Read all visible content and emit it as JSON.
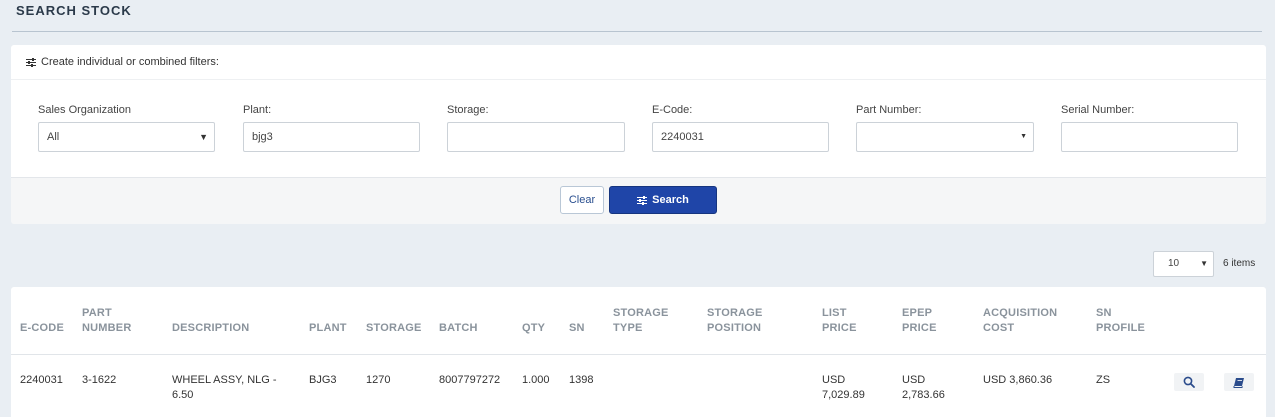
{
  "page": {
    "title": "SEARCH STOCK"
  },
  "filters": {
    "heading": "Create individual or combined filters:",
    "fields": [
      {
        "label": "Sales Organization",
        "value": "All",
        "type": "select"
      },
      {
        "label": "Plant:",
        "value": "bjg3",
        "type": "text"
      },
      {
        "label": "Storage:",
        "value": "",
        "type": "text"
      },
      {
        "label": "E-Code:",
        "value": "2240031",
        "type": "text"
      },
      {
        "label": "Part Number:",
        "value": "",
        "type": "select"
      },
      {
        "label": "Serial Number:",
        "value": "",
        "type": "text"
      }
    ],
    "clear_label": "Clear",
    "search_label": "Search"
  },
  "pager": {
    "page_size": "10",
    "items_text": "6 items"
  },
  "table": {
    "headers": {
      "ecode": [
        "E-CODE"
      ],
      "part_number": [
        "PART",
        "NUMBER"
      ],
      "description": [
        "DESCRIPTION"
      ],
      "plant": [
        "PLANT"
      ],
      "storage": [
        "STORAGE"
      ],
      "batch": [
        "BATCH"
      ],
      "qty": [
        "QTY"
      ],
      "sn": [
        "SN"
      ],
      "storage_type": [
        "STORAGE",
        "TYPE"
      ],
      "storage_position": [
        "STORAGE",
        "POSITION"
      ],
      "list_price": [
        "LIST",
        "PRICE"
      ],
      "epep_price": [
        "EPEP",
        "PRICE"
      ],
      "acquisition_cost": [
        "ACQUISITION",
        "COST"
      ],
      "sn_profile": [
        "SN",
        "PROFILE"
      ]
    },
    "rows": [
      {
        "ecode": "2240031",
        "part_number": "3-1622",
        "description": [
          "WHEEL ASSY, NLG -",
          "6.50"
        ],
        "plant": "BJG3",
        "storage": "1270",
        "batch": "8007797272",
        "qty": "1.000",
        "sn": "1398",
        "storage_type": "",
        "storage_position": "",
        "list_price": [
          "USD",
          "7,029.89"
        ],
        "epep_price": [
          "USD",
          "2,783.66"
        ],
        "acquisition_cost": "USD 3,860.36",
        "sn_profile": "ZS"
      }
    ]
  },
  "icons": {
    "filter": "sliders-icon",
    "view": "magnifier-icon",
    "details": "book-icon"
  },
  "colors": {
    "primary": "#1f45a8",
    "background": "#e9eef3"
  }
}
